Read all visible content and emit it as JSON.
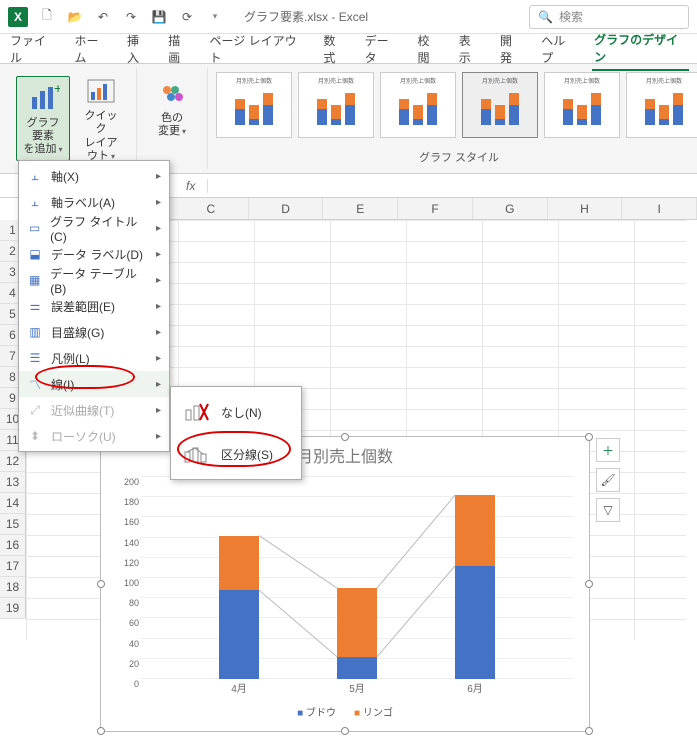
{
  "titlebar": {
    "filename": "グラフ要素.xlsx",
    "app": "Excel",
    "search_placeholder": "検索"
  },
  "tabs": {
    "file": "ファイル",
    "home": "ホーム",
    "insert": "挿入",
    "draw": "描画",
    "layout": "ページ レイアウト",
    "formula": "数式",
    "data": "データ",
    "review": "校閲",
    "view": "表示",
    "dev": "開発",
    "help": "ヘルプ",
    "chart_design": "グラフのデザイン"
  },
  "ribbon": {
    "add_element": "グラフ要素\nを追加",
    "quick_layout": "クイック\nレイアウト",
    "change_colors": "色の\n変更",
    "styles_label": "グラフ スタイル"
  },
  "menu": {
    "axes": "軸(X)",
    "axis_titles": "軸ラベル(A)",
    "chart_title": "グラフ タイトル(C)",
    "data_labels": "データ ラベル(D)",
    "data_table": "データ テーブル(B)",
    "error_bars": "誤差範囲(E)",
    "gridlines": "目盛線(G)",
    "legend": "凡例(L)",
    "lines": "線(I)",
    "trendline": "近似曲線(T)",
    "updown_bars": "ローソク(U)"
  },
  "submenu": {
    "none": "なし(N)",
    "series_lines": "区分線(S)"
  },
  "columns": [
    "C",
    "D",
    "E",
    "F",
    "G",
    "H",
    "I"
  ],
  "chart_data": {
    "type": "bar",
    "title": "月別売上個数",
    "categories": [
      "4月",
      "5月",
      "6月"
    ],
    "series": [
      {
        "name": "ブドウ",
        "values": [
          88,
          22,
          112
        ]
      },
      {
        "name": "リンゴ",
        "values": [
          54,
          68,
          70
        ]
      }
    ],
    "ylim": [
      0,
      200
    ],
    "y_ticks": [
      0,
      20,
      40,
      60,
      80,
      100,
      120,
      140,
      160,
      180,
      200
    ],
    "legend_position": "bottom",
    "stacked": true
  }
}
